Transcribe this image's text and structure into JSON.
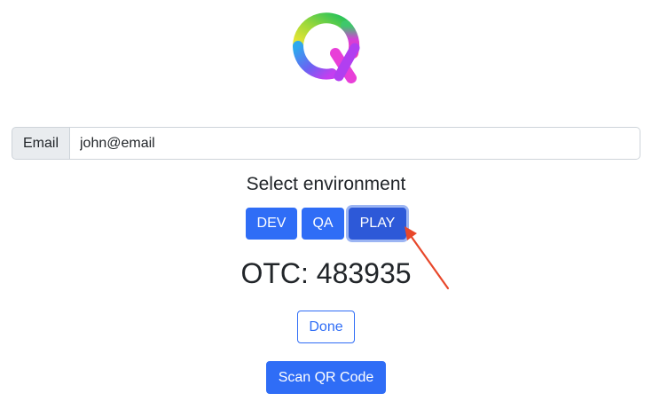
{
  "email": {
    "label": "Email",
    "value": "john@email"
  },
  "environment": {
    "heading": "Select environment",
    "options": [
      "DEV",
      "QA",
      "PLAY"
    ],
    "selected": "PLAY"
  },
  "otc": {
    "text": "OTC: 483935"
  },
  "actions": {
    "done_label": "Done",
    "scan_label": "Scan QR Code"
  },
  "colors": {
    "primary": "#2f6df6",
    "primary_active": "#2d59d8",
    "annotation_arrow": "#e8472a"
  },
  "icons": {
    "logo": "q-logo-icon",
    "annotation": "red-arrow-icon"
  }
}
